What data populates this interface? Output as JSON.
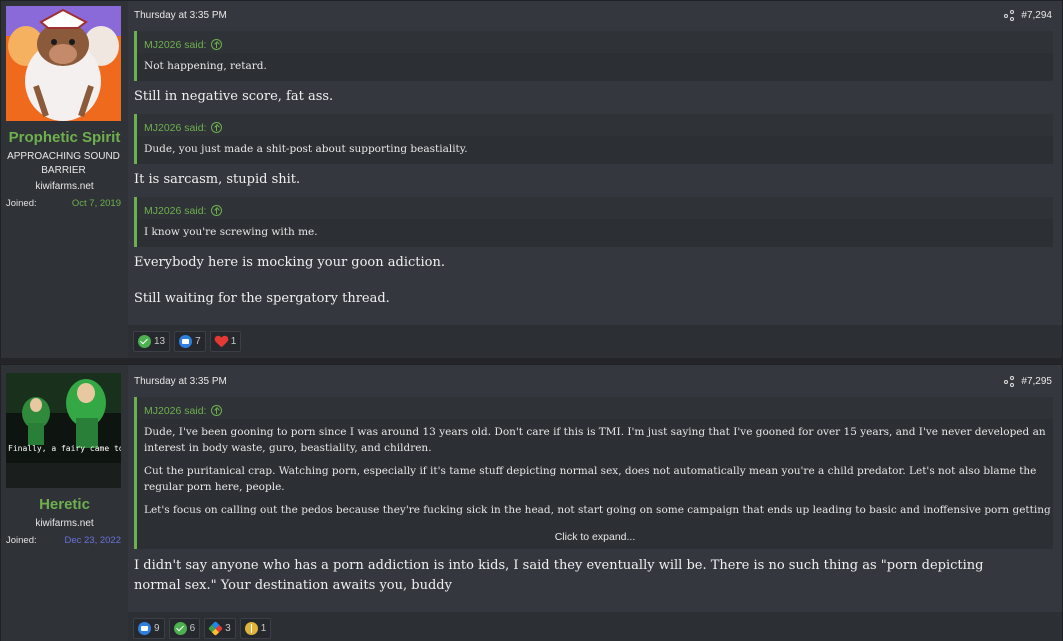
{
  "posts": [
    {
      "user": {
        "name": "Prophetic Spirit",
        "title": "APPROACHING SOUND BARRIER",
        "site": "kiwifarms.net",
        "joined_label": "Joined:",
        "joined_date": "Oct 7, 2019",
        "joined_color": "#6eb04e"
      },
      "timestamp": "Thursday at 3:35 PM",
      "number": "#7,294",
      "blocks": [
        {
          "type": "quote",
          "author": "MJ2026 said:",
          "text": "Not happening, retard."
        },
        {
          "type": "text",
          "text": "Still in negative score, fat ass."
        },
        {
          "type": "quote",
          "author": "MJ2026 said:",
          "text": "Dude, you just made a shit-post about supporting beastiality."
        },
        {
          "type": "text",
          "text": "It is sarcasm, stupid shit."
        },
        {
          "type": "quote",
          "author": "MJ2026 said:",
          "text": "I know you're screwing with me."
        },
        {
          "type": "text",
          "text": "Everybody here is mocking your goon adiction."
        },
        {
          "type": "text",
          "text": "Still waiting for the spergatory thread."
        }
      ],
      "reactions": [
        {
          "icon": "check-icon",
          "count": "13"
        },
        {
          "icon": "like-icon",
          "count": "7"
        },
        {
          "icon": "heart-icon",
          "count": "1"
        }
      ]
    },
    {
      "user": {
        "name": "Heretic",
        "site": "kiwifarms.net",
        "joined_label": "Joined:",
        "joined_date": "Dec 23, 2022",
        "joined_color": "#6a72d8",
        "avatar_caption": "Finally, a fairy came to you, fag!"
      },
      "timestamp": "Thursday at 3:35 PM",
      "number": "#7,295",
      "quote": {
        "author": "MJ2026 said:",
        "paragraphs": [
          "Dude, I've been gooning to porn since I was around 13 years old. Don't care if this is TMI. I'm just saying that I've gooned for over 15 years, and I've never developed an interest in body waste, guro, beastiality, and children.",
          "Cut the puritanical crap. Watching porn, especially if it's tame stuff depicting normal sex, does not automatically mean you're a child predator. Let's not also blame the regular porn here, people.",
          "Let's focus on calling out the pedos because they're fucking sick in the head, not start going on some campaign that ends up leading to basic and inoffensive porn getting axed off"
        ],
        "expand": "Click to expand..."
      },
      "text": "I didn't say anyone who has a porn addiction is into kids, I said they eventually will be. There is no such thing as \"porn depicting normal sex.\" Your destination awaits you, buddy",
      "reactions": [
        {
          "icon": "like-icon",
          "count": "9"
        },
        {
          "icon": "check-icon",
          "count": "6"
        },
        {
          "icon": "winner-icon",
          "count": "3"
        },
        {
          "icon": "gold-icon",
          "count": "1"
        }
      ]
    }
  ]
}
